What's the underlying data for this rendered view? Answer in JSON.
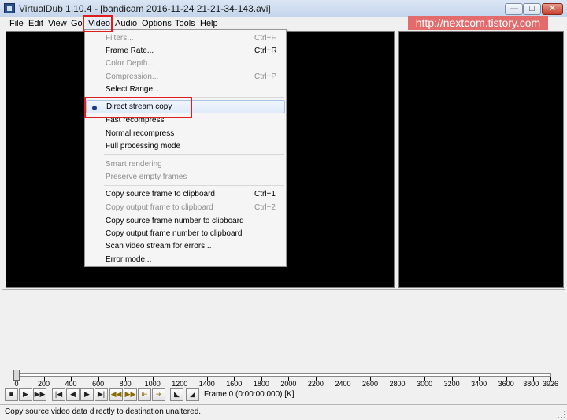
{
  "window": {
    "title": "VirtualDub 1.10.4 - [bandicam 2016-11-24 21-21-34-143.avi]",
    "minimize_glyph": "—",
    "maximize_glyph": "□",
    "close_glyph": "✕"
  },
  "watermark": "http://nextcom.tistory.com",
  "menubar": [
    {
      "label": "File"
    },
    {
      "label": "Edit"
    },
    {
      "label": "View"
    },
    {
      "label": "Go"
    },
    {
      "label": "Video"
    },
    {
      "label": "Audio"
    },
    {
      "label": "Options"
    },
    {
      "label": "Tools"
    },
    {
      "label": "Help"
    }
  ],
  "video_menu": {
    "items": [
      {
        "label": "Filters...",
        "shortcut": "Ctrl+F",
        "enabled": false
      },
      {
        "label": "Frame Rate...",
        "shortcut": "Ctrl+R",
        "enabled": true
      },
      {
        "label": "Color Depth...",
        "shortcut": "",
        "enabled": false
      },
      {
        "label": "Compression...",
        "shortcut": "Ctrl+P",
        "enabled": false
      },
      {
        "label": "Select Range...",
        "shortcut": "",
        "enabled": true
      },
      {
        "label": "Direct stream copy",
        "shortcut": "",
        "enabled": true,
        "checked": true
      },
      {
        "label": "Fast recompress",
        "shortcut": "",
        "enabled": true
      },
      {
        "label": "Normal recompress",
        "shortcut": "",
        "enabled": true
      },
      {
        "label": "Full processing mode",
        "shortcut": "",
        "enabled": true
      },
      {
        "label": "Smart rendering",
        "shortcut": "",
        "enabled": false
      },
      {
        "label": "Preserve empty frames",
        "shortcut": "",
        "enabled": false
      },
      {
        "label": "Copy source frame to clipboard",
        "shortcut": "Ctrl+1",
        "enabled": true
      },
      {
        "label": "Copy output frame to clipboard",
        "shortcut": "Ctrl+2",
        "enabled": false
      },
      {
        "label": "Copy source frame number to clipboard",
        "shortcut": "",
        "enabled": true
      },
      {
        "label": "Copy output frame number to clipboard",
        "shortcut": "",
        "enabled": true
      },
      {
        "label": "Scan video stream for errors...",
        "shortcut": "",
        "enabled": true
      },
      {
        "label": "Error mode...",
        "shortcut": "",
        "enabled": true
      }
    ]
  },
  "timeline": {
    "ticks": [
      "0",
      "200",
      "400",
      "600",
      "800",
      "1000",
      "1200",
      "1400",
      "1600",
      "1800",
      "2000",
      "2200",
      "2400",
      "2600",
      "2800",
      "3000",
      "3200",
      "3400",
      "3600",
      "3800",
      "3926"
    ],
    "position_frame": 0
  },
  "toolbar": {
    "buttons": [
      {
        "icon": "stop-icon",
        "glyph": "■"
      },
      {
        "icon": "play-input-icon",
        "glyph": "▶"
      },
      {
        "icon": "play-output-icon",
        "glyph": "▶▶"
      },
      {
        "icon": "go-start-icon",
        "glyph": "|◀"
      },
      {
        "icon": "prev-frame-icon",
        "glyph": "◀"
      },
      {
        "icon": "next-frame-icon",
        "glyph": "▶"
      },
      {
        "icon": "go-end-icon",
        "glyph": "▶|"
      },
      {
        "icon": "prev-key-icon",
        "glyph": "◀◀"
      },
      {
        "icon": "next-key-icon",
        "glyph": "▶▶"
      },
      {
        "icon": "prev-scene-icon",
        "glyph": "⇤"
      },
      {
        "icon": "next-scene-icon",
        "glyph": "⇥"
      },
      {
        "icon": "mark-in-icon",
        "glyph": "◣"
      },
      {
        "icon": "mark-out-icon",
        "glyph": "◢"
      }
    ],
    "frame_text": "Frame 0 (0:00:00.000) [K]"
  },
  "statusbar": {
    "text": "Copy source video data directly to destination unaltered."
  }
}
